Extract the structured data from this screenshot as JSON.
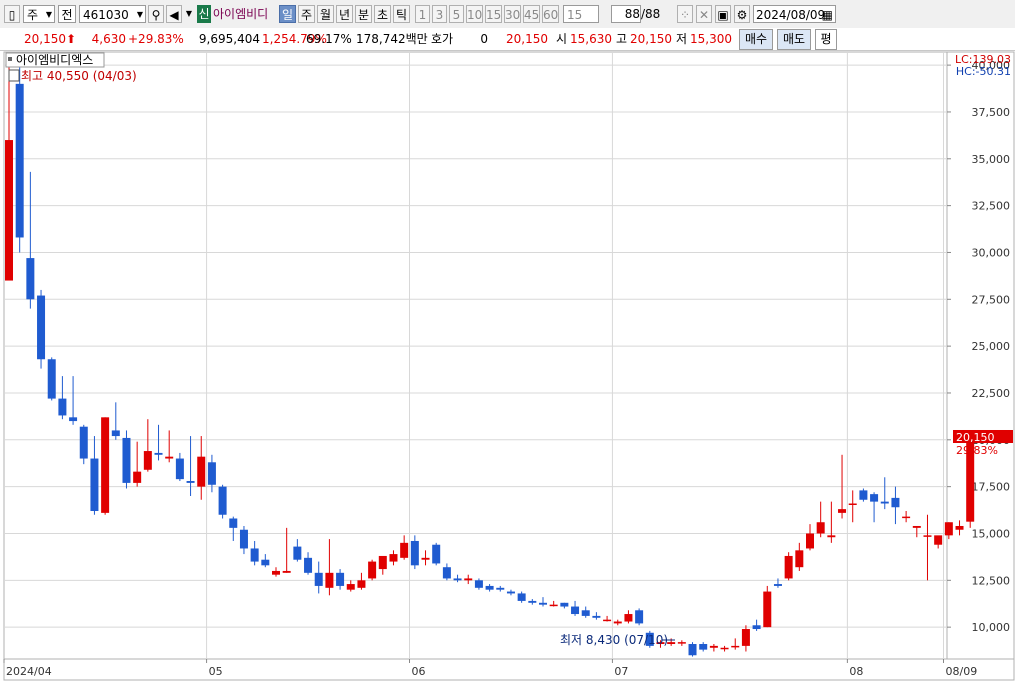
{
  "toolbar": {
    "period_select": "주",
    "market_select": "전",
    "code": "461030",
    "new_badge": "신",
    "stock_name": "아이엠비디",
    "periods": [
      "일",
      "주",
      "월",
      "년",
      "분",
      "초",
      "틱"
    ],
    "minutes": [
      "1",
      "3",
      "5",
      "10",
      "15",
      "30",
      "45",
      "60"
    ],
    "custom_minute": "15",
    "count_current": "88",
    "count_total": "/88",
    "date": "2024/08/09",
    "selected_period": "일"
  },
  "info": {
    "price": "20,150",
    "change": "4,630",
    "change_pct": "+29.83%",
    "volume": "9,695,404",
    "volume_pct": "1,254.79%",
    "turnover": "69.17%",
    "amount": "178,742백만",
    "quote_label": "호가",
    "quote_value": "0",
    "quote_price": "20,150",
    "open_label": "시",
    "open": "15,630",
    "high_label": "고",
    "high": "20,150",
    "low_label": "저",
    "low": "15,300",
    "buy_button": "매수",
    "sell_button": "매도",
    "avg_button": "평"
  },
  "colors": {
    "up": "#e00000",
    "down": "#1f5bd0",
    "grid": "#d8d8d8",
    "accent": "#e00000"
  },
  "chart_data": {
    "type": "candlestick",
    "title": "아이엠비디엑스",
    "lc_label": "LC:139.03",
    "hc_label": "HC:-50.31",
    "current_price_label": "20,150",
    "current_pct_label": "29.83%",
    "high_annotation": "최고 40,550 (04/03)",
    "low_annotation": "최저 8,430 (07/10)",
    "ylim": [
      8300,
      40700
    ],
    "y_ticks": [
      10000,
      12500,
      15000,
      17500,
      20000,
      22500,
      25000,
      27500,
      30000,
      32500,
      35000,
      37500,
      40000
    ],
    "y_tick_labels": [
      "10,000",
      "12,500",
      "15,000",
      "17,500",
      "20,000",
      "22,500",
      "25,000",
      "27,500",
      "30,000",
      "32,500",
      "35,000",
      "37,500",
      "40,000"
    ],
    "x_labels": [
      {
        "index": 0,
        "label": "2024/04"
      },
      {
        "index": 19,
        "label": "05"
      },
      {
        "index": 38,
        "label": "06"
      },
      {
        "index": 57,
        "label": "07"
      },
      {
        "index": 79,
        "label": "08"
      },
      {
        "index": 88,
        "label": "08/09"
      }
    ],
    "candles": [
      [
        28500,
        40550,
        28500,
        36000
      ],
      [
        39000,
        40000,
        30000,
        30800
      ],
      [
        29700,
        34300,
        27000,
        27500
      ],
      [
        27700,
        28000,
        23800,
        24300
      ],
      [
        24300,
        24400,
        22100,
        22200
      ],
      [
        22200,
        23400,
        21100,
        21300
      ],
      [
        21200,
        23400,
        20800,
        21000
      ],
      [
        20700,
        20800,
        18700,
        19000
      ],
      [
        19000,
        20200,
        16000,
        16200
      ],
      [
        16100,
        21200,
        16000,
        21200
      ],
      [
        20500,
        22000,
        20000,
        20200
      ],
      [
        20100,
        20500,
        17400,
        17700
      ],
      [
        17700,
        19900,
        17500,
        18300
      ],
      [
        18400,
        21100,
        18300,
        19400
      ],
      [
        19300,
        20800,
        18900,
        19200
      ],
      [
        19000,
        20500,
        18800,
        19100
      ],
      [
        19000,
        19300,
        17800,
        17900
      ],
      [
        17800,
        20200,
        17000,
        17700
      ],
      [
        17500,
        20200,
        16800,
        19100
      ],
      [
        18800,
        19200,
        17200,
        17600
      ],
      [
        17500,
        17600,
        15800,
        16000
      ],
      [
        15800,
        15900,
        14600,
        15300
      ],
      [
        15200,
        15400,
        13900,
        14200
      ],
      [
        14200,
        14600,
        13300,
        13500
      ],
      [
        13600,
        13900,
        13200,
        13300
      ],
      [
        12800,
        13200,
        12700,
        13000
      ],
      [
        12900,
        15300,
        12900,
        13000
      ],
      [
        14300,
        14700,
        13500,
        13600
      ],
      [
        13700,
        14000,
        12800,
        12900
      ],
      [
        12900,
        13500,
        11800,
        12200
      ],
      [
        12100,
        14700,
        11700,
        12900
      ],
      [
        12900,
        13100,
        12000,
        12200
      ],
      [
        12000,
        12500,
        11900,
        12300
      ],
      [
        12100,
        12900,
        12000,
        12500
      ],
      [
        12600,
        13600,
        12500,
        13500
      ],
      [
        13100,
        13600,
        12800,
        13800
      ],
      [
        13500,
        14100,
        13300,
        13900
      ],
      [
        13700,
        14900,
        13600,
        14500
      ],
      [
        14600,
        14900,
        13100,
        13300
      ],
      [
        13600,
        14100,
        13300,
        13700
      ],
      [
        14400,
        14500,
        13300,
        13400
      ],
      [
        13200,
        13400,
        12500,
        12600
      ],
      [
        12600,
        12800,
        12400,
        12500
      ],
      [
        12500,
        12800,
        12300,
        12600
      ],
      [
        12500,
        12600,
        12000,
        12100
      ],
      [
        12200,
        12300,
        11900,
        12000
      ],
      [
        12100,
        12200,
        11900,
        12000
      ],
      [
        11900,
        12000,
        11700,
        11800
      ],
      [
        11800,
        11900,
        11300,
        11400
      ],
      [
        11400,
        11500,
        11200,
        11300
      ],
      [
        11300,
        11600,
        11100,
        11200
      ],
      [
        11200,
        11400,
        11100,
        11200
      ],
      [
        11300,
        11300,
        11000,
        11100
      ],
      [
        11100,
        11400,
        10600,
        10700
      ],
      [
        10900,
        11100,
        10500,
        10600
      ],
      [
        10600,
        10800,
        10400,
        10500
      ],
      [
        10400,
        10600,
        10300,
        10400
      ],
      [
        10200,
        10400,
        10100,
        10300
      ],
      [
        10300,
        10900,
        10200,
        10700
      ],
      [
        10900,
        11000,
        10100,
        10200
      ],
      [
        9700,
        9800,
        8900,
        9000
      ],
      [
        9100,
        9300,
        8900,
        9200
      ],
      [
        9100,
        9400,
        9000,
        9200
      ],
      [
        9200,
        9300,
        9000,
        9200
      ],
      [
        9100,
        9200,
        8430,
        8500
      ],
      [
        9100,
        9200,
        8700,
        8800
      ],
      [
        8900,
        9100,
        8700,
        9000
      ],
      [
        8900,
        9000,
        8700,
        8900
      ],
      [
        9000,
        9400,
        8800,
        9000
      ],
      [
        9000,
        10100,
        8700,
        9900
      ],
      [
        10100,
        10400,
        9800,
        9900
      ],
      [
        10000,
        12200,
        10000,
        11900
      ],
      [
        12300,
        12600,
        12100,
        12200
      ],
      [
        12600,
        14000,
        12500,
        13800
      ],
      [
        13200,
        14500,
        13000,
        14100
      ],
      [
        14200,
        15500,
        14100,
        15000
      ],
      [
        15000,
        16700,
        14800,
        15600
      ],
      [
        14800,
        16700,
        14500,
        14900
      ],
      [
        16100,
        19200,
        15800,
        16300
      ],
      [
        16600,
        17300,
        15600,
        16600
      ],
      [
        17300,
        17400,
        16700,
        16800
      ],
      [
        17100,
        17200,
        15600,
        16700
      ],
      [
        16700,
        18000,
        16300,
        16600
      ],
      [
        16900,
        17500,
        15500,
        16400
      ],
      [
        15900,
        16200,
        15600,
        15900
      ],
      [
        15300,
        15400,
        14800,
        15400
      ],
      [
        14900,
        16000,
        12500,
        14900
      ],
      [
        14400,
        14700,
        14200,
        14900
      ],
      [
        14900,
        15600,
        14700,
        15600
      ],
      [
        15200,
        15700,
        14900,
        15400
      ],
      [
        15630,
        20150,
        15300,
        20150
      ]
    ]
  }
}
